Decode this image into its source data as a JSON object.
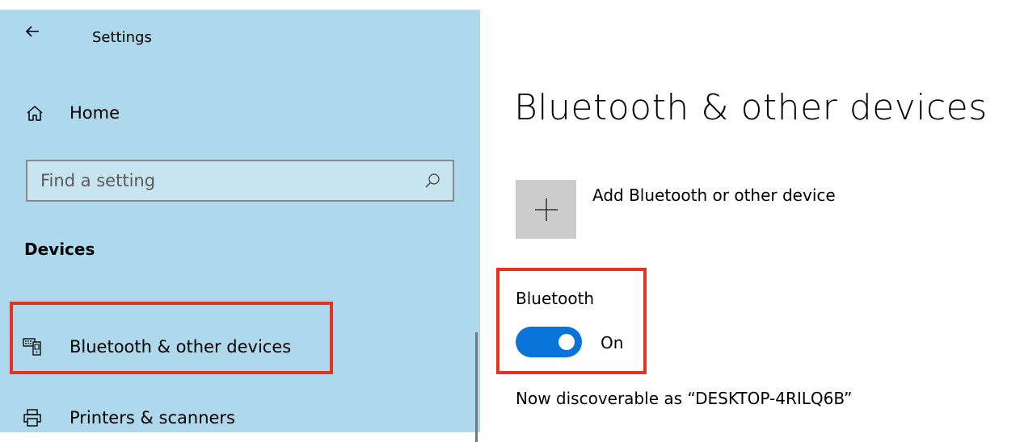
{
  "window": {
    "title": "Settings"
  },
  "sidebar": {
    "home_label": "Home",
    "search": {
      "placeholder": "Find a setting"
    },
    "section_heading": "Devices",
    "items": [
      {
        "label": "Bluetooth & other devices",
        "icon": "keyboard-phone-icon",
        "selected": true
      },
      {
        "label": "Printers & scanners",
        "icon": "printer-icon",
        "selected": false
      }
    ]
  },
  "main": {
    "page_title": "Bluetooth & other devices",
    "add_device_label": "Add Bluetooth or other device",
    "bluetooth_label": "Bluetooth",
    "bluetooth_toggle_state": "On",
    "discoverable_text": "Now discoverable as “DESKTOP-4RILQ6B”"
  },
  "colors": {
    "sidebar_bg": "#aed8eb",
    "accent": "#0a73d9",
    "highlight": "#e8321e"
  }
}
